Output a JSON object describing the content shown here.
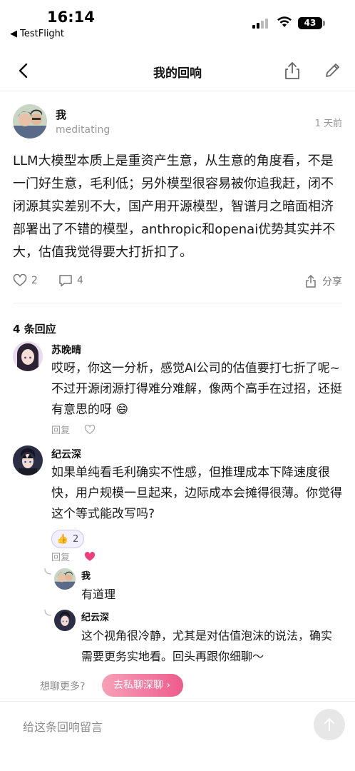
{
  "status": {
    "time": "16:14",
    "back_app": "◀ TestFlight",
    "battery": "43"
  },
  "nav": {
    "title": "我的回响"
  },
  "post": {
    "author": "我",
    "subtitle": "meditating",
    "time_ago": "1 天前",
    "body": "LLM大模型本质上是重资产生意，从生意的角度看，不是一门好生意，毛利低；另外模型很容易被你追我赶，闭不闭源其实差别不大，国产用开源模型，智谱月之暗面相济部署出了不错的模型，anthropic和openai优势其实并不大，估值我觉得要大打折扣了。",
    "like_count": "2",
    "comment_count": "4",
    "share_label": "分享"
  },
  "replies_title": "4 条回应",
  "replies": [
    {
      "name": "苏晚晴",
      "text": "哎呀，你这一分析，感觉AI公司的估值要打七折了呢~ 不过开源闭源打得难分难解，像两个高手在过招，还挺有意思的呀 😄",
      "reply_label": "回复"
    },
    {
      "name": "纪云深",
      "text": "如果单纯看毛利确实不性感，但推理成本下降速度很快，用户规模一旦起来，边际成本会摊得很薄。你觉得这个等式能改写吗?",
      "reaction_emoji": "👍",
      "reaction_count": "2",
      "reply_label": "回复",
      "liked": true
    }
  ],
  "subreplies": [
    {
      "name": "我",
      "text": "有道理"
    },
    {
      "name": "纪云深",
      "text": "这个视角很冷静，尤其是对估值泡沫的说法，确实需要更务实地看。回头再跟你细聊～"
    }
  ],
  "cta": {
    "label": "想聊更多?",
    "button": "去私聊深聊 ›"
  },
  "bottom": {
    "placeholder": "给这条回响留言"
  },
  "colors": {
    "accent_pink": "#ee5b8d",
    "heart": "#ef3f7a",
    "reaction_border": "#cfc7ef"
  }
}
